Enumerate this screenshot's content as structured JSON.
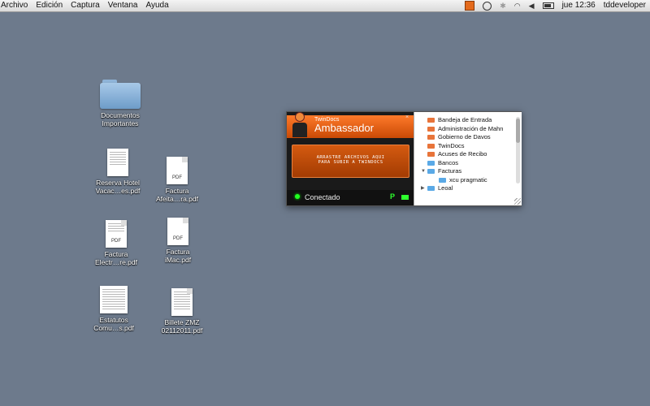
{
  "menubar": {
    "menus": [
      "Archivo",
      "Edición",
      "Captura",
      "Ventana",
      "Ayuda"
    ],
    "status_icons": [
      "twindocs-icon",
      "time-machine-icon",
      "bluetooth-icon",
      "wifi-icon",
      "volume-icon",
      "battery-icon"
    ],
    "clock": "jue 12:36",
    "user": "tddeveloper"
  },
  "desktop": {
    "icons": [
      {
        "type": "folder",
        "label1": "Documentos",
        "label2": "Importantes"
      },
      {
        "type": "pdf",
        "label1": "Reserva Hotel",
        "label2": "Vacac…es.pdf"
      },
      {
        "type": "pdf",
        "label1": "Factura",
        "label2": "Afeita…ra.pdf"
      },
      {
        "type": "pdf",
        "label1": "Factura",
        "label2": "Electr…re.pdf"
      },
      {
        "type": "pdf",
        "label1": "Factura",
        "label2": "iMac.pdf"
      },
      {
        "type": "pdf",
        "label1": "Estatutos",
        "label2": "Comu…s.pdf"
      },
      {
        "type": "pdf",
        "label1": "Billete ZMZ",
        "label2": "02112011.pdf"
      }
    ],
    "pdf_badge": "PDF"
  },
  "widget": {
    "brand": "TwinDocs",
    "title": "Ambassador",
    "close": "×",
    "drop_line1": "ARRASTRE ARCHIVOS AQUI",
    "drop_line2": "PARA SUBIR A TWINDOCS",
    "status": "Conectado",
    "p_label": "P",
    "colors": {
      "accent": "#e0621a",
      "status_green": "#2dff2d",
      "folder_orange": "#e8743a",
      "folder_blue": "#5aa9e6"
    },
    "tree": [
      {
        "label": "Bandeja de Entrada",
        "color": "orange",
        "indent": 0,
        "toggle": ""
      },
      {
        "label": "Administración de Mahn",
        "color": "orange",
        "indent": 0,
        "toggle": ""
      },
      {
        "label": "Gobierno de Davos",
        "color": "orange",
        "indent": 0,
        "toggle": ""
      },
      {
        "label": "TwinDocs",
        "color": "orange",
        "indent": 0,
        "toggle": ""
      },
      {
        "label": "Acuses de Recibo",
        "color": "orange",
        "indent": 0,
        "toggle": ""
      },
      {
        "label": "Bancos",
        "color": "blue",
        "indent": 0,
        "toggle": ""
      },
      {
        "label": "Facturas",
        "color": "blue",
        "indent": 0,
        "toggle": "▼"
      },
      {
        "label": "xcu pragmatic",
        "color": "blue",
        "indent": 1,
        "toggle": ""
      },
      {
        "label": "Leoal",
        "color": "blue",
        "indent": 0,
        "toggle": "▶"
      }
    ]
  }
}
